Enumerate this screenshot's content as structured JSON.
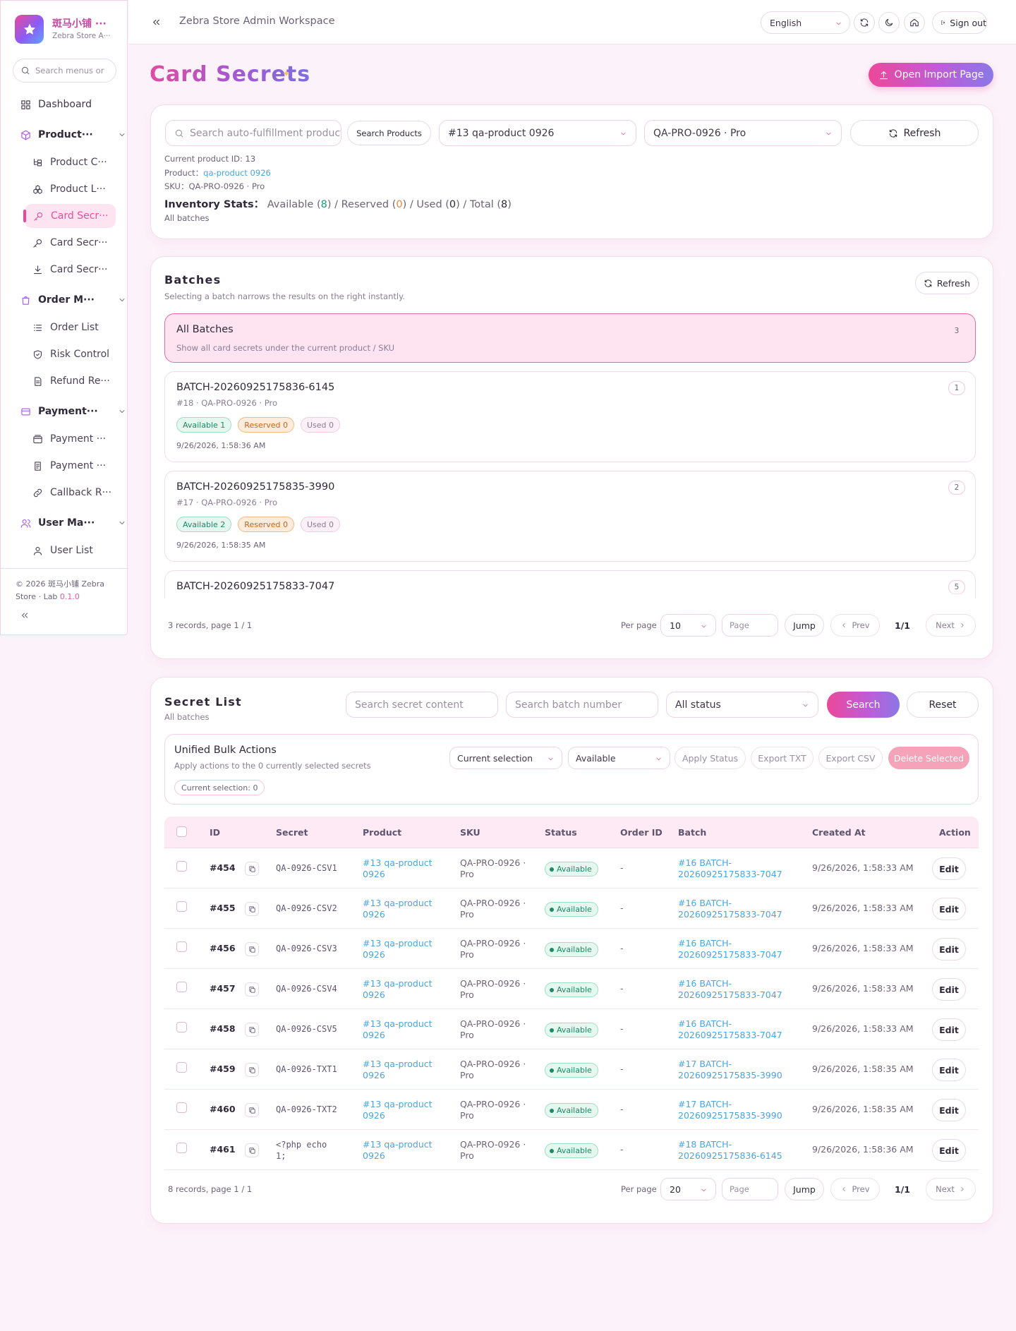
{
  "brand": {
    "name": "斑马小铺 ···",
    "subtitle": "Zebra Store A···"
  },
  "sidebar": {
    "search_placeholder": "Search menus or p",
    "items": [
      {
        "label": "Dashboard"
      },
      {
        "label": "Product···"
      },
      {
        "label": "Product C···"
      },
      {
        "label": "Product L···"
      },
      {
        "label": "Card Secr···"
      },
      {
        "label": "Card Secr···"
      },
      {
        "label": "Card Secr···"
      },
      {
        "label": "Order M···"
      },
      {
        "label": "Order List"
      },
      {
        "label": "Risk Control"
      },
      {
        "label": "Refund Re···"
      },
      {
        "label": "Payment···"
      },
      {
        "label": "Payment ···"
      },
      {
        "label": "Payment ···"
      },
      {
        "label": "Callback R···"
      },
      {
        "label": "User Ma···"
      },
      {
        "label": "User List"
      }
    ],
    "copyright": "© 2026 斑马小铺 Zebra Store · Lab",
    "version": "0.1.0"
  },
  "topbar": {
    "title": "Zebra Store Admin Workspace",
    "language": "English",
    "signout": "Sign out"
  },
  "page": {
    "title": "Card Secrets",
    "import_button": "Open Import Page"
  },
  "filter": {
    "search_placeholder": "Search auto-fulfillment products",
    "search_button": "Search Products",
    "product_select": "#13 qa-product 0926",
    "sku_select": "QA-PRO-0926 · Pro",
    "refresh": "Refresh",
    "product_id_line": "Current product ID: 13",
    "product_label": "Product：",
    "product_link": "qa-product 0926",
    "sku_line": "SKU：QA-PRO-0926 · Pro",
    "stats_label": "Inventory Stats：",
    "stats": {
      "available_label": "Available (",
      "available": "8",
      "reserved_label": ") / Reserved (",
      "reserved": "0",
      "used_label": ") / Used (",
      "used": "0",
      "total_label": ") / Total (",
      "total": "8",
      "end": ")"
    },
    "scope": "All batches"
  },
  "batches": {
    "title": "Batches",
    "subtitle": "Selecting a batch narrows the results on the right instantly.",
    "refresh": "Refresh",
    "all": {
      "name": "All Batches",
      "desc": "Show all card secrets under the current product / SKU",
      "count": "3"
    },
    "items": [
      {
        "name": "BATCH-20260925175836-6145",
        "meta": "#18 · QA-PRO-0926 · Pro",
        "count": "1",
        "available": "Available 1",
        "reserved": "Reserved 0",
        "used": "Used 0",
        "time": "9/26/2026, 1:58:36 AM"
      },
      {
        "name": "BATCH-20260925175835-3990",
        "meta": "#17 · QA-PRO-0926 · Pro",
        "count": "2",
        "available": "Available 2",
        "reserved": "Reserved 0",
        "used": "Used 0",
        "time": "9/26/2026, 1:58:35 AM"
      },
      {
        "name": "BATCH-20260925175833-7047",
        "count": "5"
      }
    ],
    "pager": {
      "records": "3 records, page 1 / 1",
      "per_page_label": "Per page",
      "per_page": "10",
      "page_placeholder": "Page",
      "jump": "Jump",
      "prev": "Prev",
      "page": "1/1",
      "next": "Next"
    }
  },
  "secrets": {
    "title": "Secret List",
    "subtitle": "All batches",
    "search_placeholder": "Search secret content",
    "batch_placeholder": "Search batch number",
    "status_select": "All status",
    "search": "Search",
    "reset": "Reset",
    "bulk": {
      "title": "Unified Bulk Actions",
      "desc": "Apply actions to the 0 currently selected secrets",
      "current": "Current selection: 0",
      "scope_select": "Current selection",
      "status_select": "Available",
      "apply": "Apply Status",
      "export_txt": "Export TXT",
      "export_csv": "Export CSV",
      "delete": "Delete Selected"
    },
    "columns": [
      "ID",
      "Secret",
      "Product",
      "SKU",
      "Status",
      "Order ID",
      "Batch",
      "Created At",
      "Action"
    ],
    "rows": [
      {
        "id": "#454",
        "secret": "QA-0926-CSV1",
        "product": [
          "#13 qa-product",
          "0926"
        ],
        "sku": [
          "QA-PRO-0926 ·",
          "Pro"
        ],
        "status": "Available",
        "order": "-",
        "batch": [
          "#16 BATCH-",
          "20260925175833-7047"
        ],
        "created": "9/26/2026, 1:58:33 AM",
        "action": "Edit"
      },
      {
        "id": "#455",
        "secret": "QA-0926-CSV2",
        "product": [
          "#13 qa-product",
          "0926"
        ],
        "sku": [
          "QA-PRO-0926 ·",
          "Pro"
        ],
        "status": "Available",
        "order": "-",
        "batch": [
          "#16 BATCH-",
          "20260925175833-7047"
        ],
        "created": "9/26/2026, 1:58:33 AM",
        "action": "Edit"
      },
      {
        "id": "#456",
        "secret": "QA-0926-CSV3",
        "product": [
          "#13 qa-product",
          "0926"
        ],
        "sku": [
          "QA-PRO-0926 ·",
          "Pro"
        ],
        "status": "Available",
        "order": "-",
        "batch": [
          "#16 BATCH-",
          "20260925175833-7047"
        ],
        "created": "9/26/2026, 1:58:33 AM",
        "action": "Edit"
      },
      {
        "id": "#457",
        "secret": "QA-0926-CSV4",
        "product": [
          "#13 qa-product",
          "0926"
        ],
        "sku": [
          "QA-PRO-0926 ·",
          "Pro"
        ],
        "status": "Available",
        "order": "-",
        "batch": [
          "#16 BATCH-",
          "20260925175833-7047"
        ],
        "created": "9/26/2026, 1:58:33 AM",
        "action": "Edit"
      },
      {
        "id": "#458",
        "secret": "QA-0926-CSV5",
        "product": [
          "#13 qa-product",
          "0926"
        ],
        "sku": [
          "QA-PRO-0926 ·",
          "Pro"
        ],
        "status": "Available",
        "order": "-",
        "batch": [
          "#16 BATCH-",
          "20260925175833-7047"
        ],
        "created": "9/26/2026, 1:58:33 AM",
        "action": "Edit"
      },
      {
        "id": "#459",
        "secret": "QA-0926-TXT1",
        "product": [
          "#13 qa-product",
          "0926"
        ],
        "sku": [
          "QA-PRO-0926 ·",
          "Pro"
        ],
        "status": "Available",
        "order": "-",
        "batch": [
          "#17 BATCH-",
          "20260925175835-3990"
        ],
        "created": "9/26/2026, 1:58:35 AM",
        "action": "Edit"
      },
      {
        "id": "#460",
        "secret": "QA-0926-TXT2",
        "product": [
          "#13 qa-product",
          "0926"
        ],
        "sku": [
          "QA-PRO-0926 ·",
          "Pro"
        ],
        "status": "Available",
        "order": "-",
        "batch": [
          "#17 BATCH-",
          "20260925175835-3990"
        ],
        "created": "9/26/2026, 1:58:35 AM",
        "action": "Edit"
      },
      {
        "id": "#461",
        "secret": [
          "<?php echo",
          "1;"
        ],
        "product": [
          "#13 qa-product",
          "0926"
        ],
        "sku": [
          "QA-PRO-0926 ·",
          "Pro"
        ],
        "status": "Available",
        "order": "-",
        "batch": [
          "#18 BATCH-",
          "20260925175836-6145"
        ],
        "created": "9/26/2026, 1:58:36 AM",
        "action": "Edit"
      }
    ],
    "pager": {
      "records": "8 records, page 1 / 1",
      "per_page_label": "Per page",
      "per_page": "20",
      "page_placeholder": "Page",
      "jump": "Jump",
      "prev": "Prev",
      "page": "1/1",
      "next": "Next"
    }
  },
  "colors": {
    "accent": "#e94a9a",
    "link": "#49a5e0",
    "available": "#1a8a67",
    "reserved": "#c5671f"
  }
}
